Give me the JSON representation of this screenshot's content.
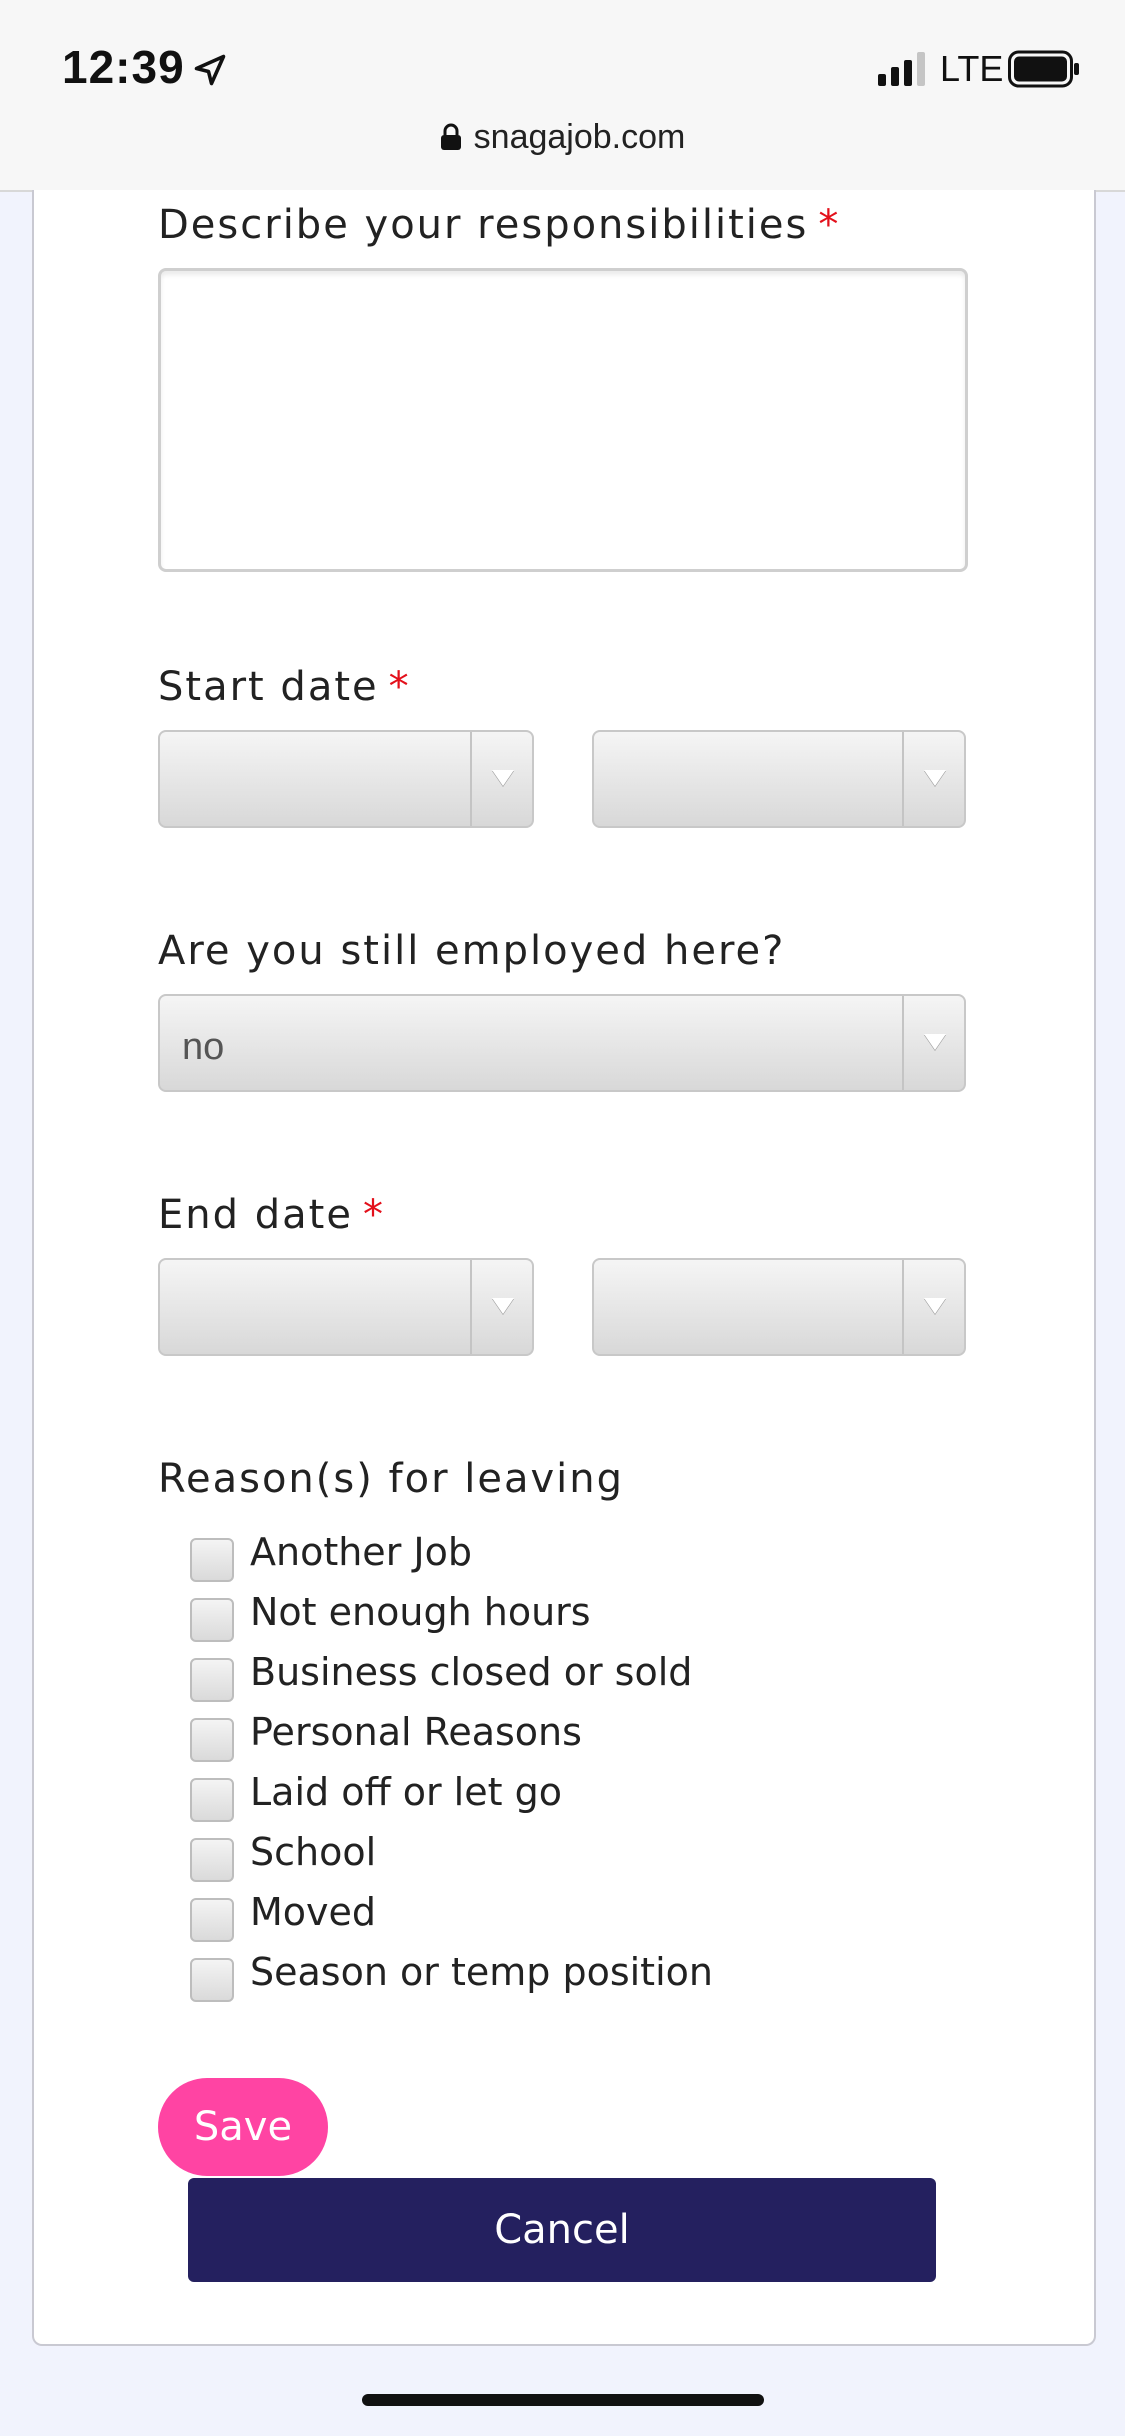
{
  "status_bar": {
    "time": "12:39",
    "network": "LTE",
    "url": "snagajob.com",
    "icons": [
      "location-arrow-icon",
      "signal-bars-icon",
      "battery-icon",
      "lock-icon"
    ]
  },
  "form": {
    "responsibilities": {
      "label": "Describe your responsibilities",
      "required": "*",
      "value": ""
    },
    "start_date": {
      "label": "Start date",
      "required": "*",
      "month_value": "",
      "year_value": ""
    },
    "still_employed": {
      "label": "Are you still employed here?",
      "value": "no"
    },
    "end_date": {
      "label": "End date",
      "required": "*",
      "month_value": "",
      "year_value": ""
    },
    "reasons": {
      "label": "Reason(s) for leaving",
      "options": [
        "Another Job",
        "Not enough hours",
        "Business closed or sold",
        "Personal Reasons",
        "Laid off or let go",
        "School",
        "Moved",
        "Season or temp position"
      ]
    },
    "save_label": "Save",
    "cancel_label": "Cancel"
  },
  "colors": {
    "required": "#e3101b",
    "save_button": "#ff44a3",
    "cancel_button": "#24205f",
    "page_background": "#f1f3fd"
  }
}
